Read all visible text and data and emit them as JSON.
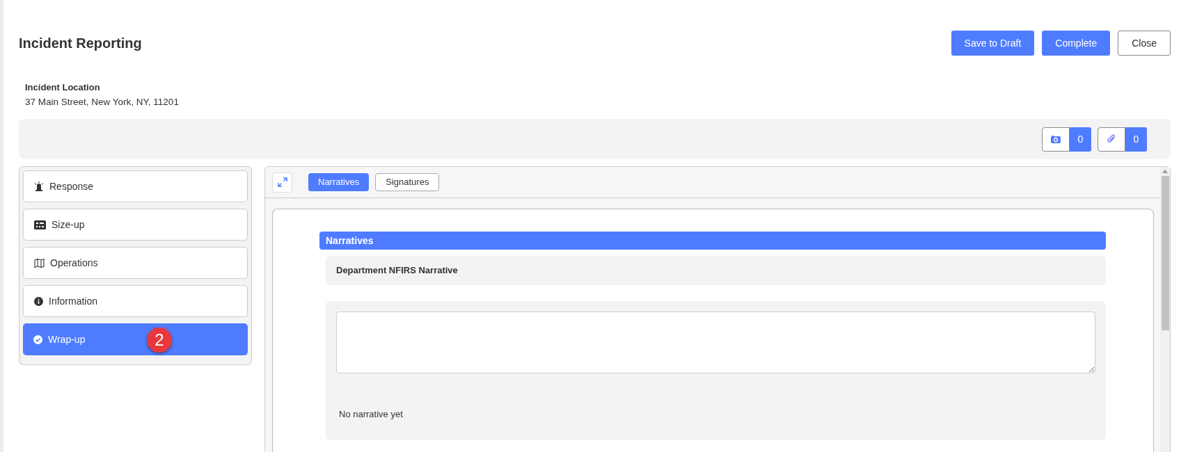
{
  "header": {
    "title": "Incident Reporting",
    "buttons": [
      {
        "label": "Save to Draft",
        "kind": "primary"
      },
      {
        "label": "Complete",
        "kind": "primary"
      },
      {
        "label": "Close",
        "kind": "outline"
      }
    ]
  },
  "location": {
    "label": "Incident Location",
    "value": "37 Main Street, New York, NY, 11201"
  },
  "counters": [
    {
      "kind": "photo",
      "count": "0"
    },
    {
      "kind": "attachment",
      "count": "0"
    }
  ],
  "sidebar": {
    "items": [
      {
        "label": "Response",
        "kind": "beacon",
        "selected": false
      },
      {
        "label": "Size-up",
        "kind": "panel",
        "selected": false
      },
      {
        "label": "Operations",
        "kind": "map",
        "selected": false
      },
      {
        "label": "Information",
        "kind": "info",
        "selected": false
      },
      {
        "label": "Wrap-up",
        "kind": "check",
        "selected": true,
        "badge": "2"
      }
    ]
  },
  "tabs": [
    {
      "label": "Narratives",
      "selected": true
    },
    {
      "label": "Signatures",
      "selected": false
    }
  ],
  "section": {
    "title": "Narratives",
    "subtitle": "Department NFIRS Narrative",
    "empty_text": "No narrative yet"
  }
}
